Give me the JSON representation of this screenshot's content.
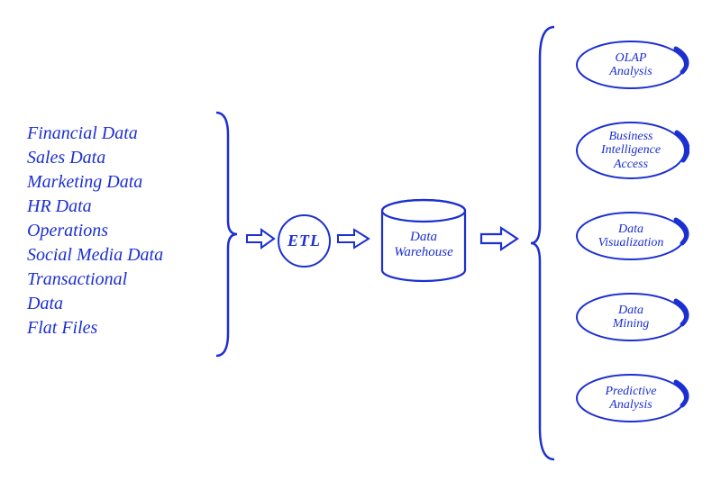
{
  "sources": [
    "Financial Data",
    "Sales Data",
    "Marketing Data",
    "HR Data",
    "Operations",
    "Social Media Data",
    "Transactional",
    "Data",
    "Flat Files"
  ],
  "etl_label": "ETL",
  "warehouse_label_1": "Data",
  "warehouse_label_2": "Warehouse",
  "outputs": [
    {
      "line1": "OLAP",
      "line2": "Analysis"
    },
    {
      "line1": "Business",
      "line2": "Intelligence",
      "line3": "Access"
    },
    {
      "line1": "Data",
      "line2": "Visualization"
    },
    {
      "line1": "Data",
      "line2": "Mining"
    },
    {
      "line1": "Predictive",
      "line2": "Analysis"
    }
  ],
  "colors": {
    "ink": "#1c2fd1"
  }
}
